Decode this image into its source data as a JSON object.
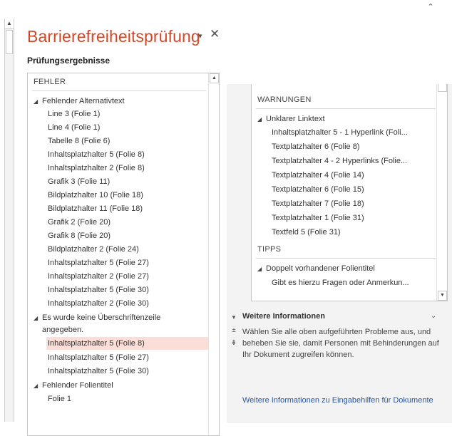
{
  "pane": {
    "title": "Barrierefreiheitsprüfung",
    "dropdown_glyph": "▾",
    "close_glyph": "✕",
    "results_heading": "Prüfungsergebnisse"
  },
  "errors": {
    "header": "FEHLER",
    "groups": [
      {
        "label": "Fehlender Alternativtext",
        "items": [
          "Line 3  (Folie 1)",
          "Line 4  (Folie 1)",
          "Tabelle 8  (Folie 6)",
          "Inhaltsplatzhalter 5  (Folie 8)",
          "Inhaltsplatzhalter 2  (Folie 8)",
          "Grafik 3  (Folie 11)",
          "Bildplatzhalter 10  (Folie 18)",
          "Bildplatzhalter 11  (Folie 18)",
          "Grafik 2  (Folie 20)",
          "Grafik 8  (Folie 20)",
          "Bildplatzhalter 2  (Folie 24)",
          "Inhaltsplatzhalter 5  (Folie 27)",
          "Inhaltsplatzhalter 2  (Folie 27)",
          "Inhaltsplatzhalter 5  (Folie 30)",
          "Inhaltsplatzhalter 2  (Folie 30)"
        ]
      },
      {
        "label_line1": "Es wurde keine Überschriftenzeile",
        "label_line2": "angegeben.",
        "items": [
          "Inhaltsplatzhalter 5  (Folie 8)",
          "Inhaltsplatzhalter 5  (Folie 27)",
          "Inhaltsplatzhalter 5  (Folie 30)"
        ]
      },
      {
        "label": "Fehlender Folientitel",
        "items": [
          "Folie 1"
        ]
      }
    ]
  },
  "warnings": {
    "header": "WARNUNGEN",
    "groups": [
      {
        "label": "Unklarer Linktext",
        "items": [
          "Inhaltsplatzhalter 5 - 1 Hyperlink (Foli...",
          "Textplatzhalter 6  (Folie 8)",
          "Textplatzhalter 4 - 2 Hyperlinks (Folie...",
          "Textplatzhalter 4  (Folie 14)",
          "Textplatzhalter 6  (Folie 15)",
          "Textplatzhalter 7  (Folie 18)",
          "Textplatzhalter 1  (Folie 31)",
          "Textfeld 5  (Folie 31)"
        ]
      }
    ]
  },
  "tips": {
    "header": "TIPPS",
    "groups": [
      {
        "label": "Doppelt vorhandener Folientitel",
        "items": [
          "Gibt es hierzu Fragen oder Anmerkun..."
        ]
      }
    ]
  },
  "more_info": {
    "title": "Weitere Informationen",
    "text": "Wählen Sie alle oben aufgeführten Probleme aus, und beheben Sie sie, damit Personen mit Behinderungen auf Ihr Dokument zugreifen können.",
    "link": "Weitere Informationen zu Eingabehilfen für Dokumente"
  },
  "colors": {
    "title_accent": "#d24726",
    "selected_row": "#fbded7",
    "link": "#2b579a"
  }
}
